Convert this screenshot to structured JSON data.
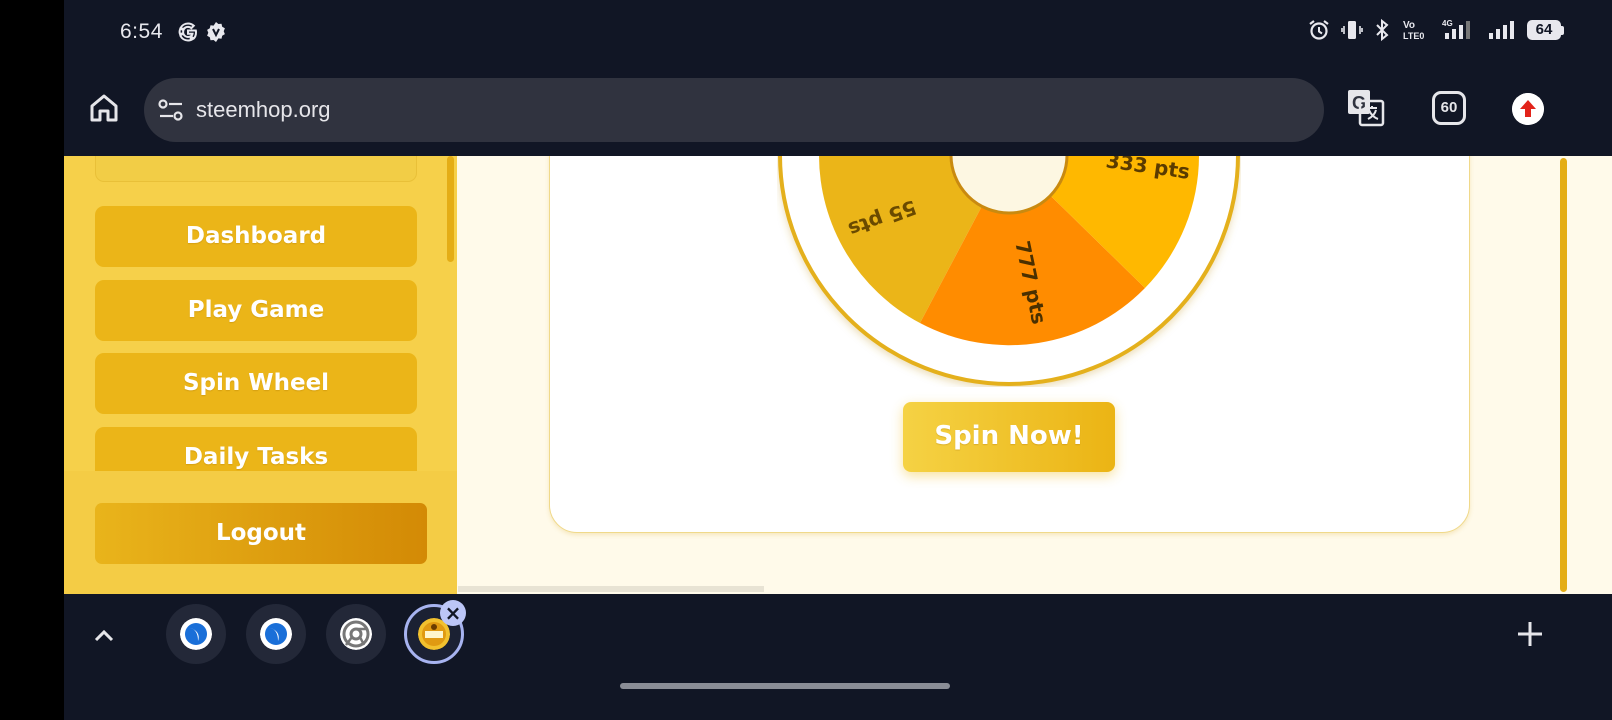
{
  "status_bar": {
    "time": "6:54",
    "battery": "64"
  },
  "browser": {
    "url": "steemhop.org",
    "tabs_count": "60"
  },
  "sidebar": {
    "items": [
      {
        "label": "Dashboard"
      },
      {
        "label": "Play Game"
      },
      {
        "label": "Spin Wheel"
      },
      {
        "label": "Daily Tasks"
      }
    ],
    "logout_label": "Logout"
  },
  "wheel": {
    "segments": [
      {
        "label": "55 pts",
        "color": "#ebb518"
      },
      {
        "label": "777 pts",
        "color": "#ff8c00"
      },
      {
        "label": "333 pts",
        "color": "#ffb800"
      }
    ]
  },
  "spin_button": "Spin Now!",
  "colors": {
    "accent": "#ebb518",
    "sidebar_bg": "#f6d04a",
    "page_bg": "#fffaea",
    "system_bg": "#111625"
  }
}
